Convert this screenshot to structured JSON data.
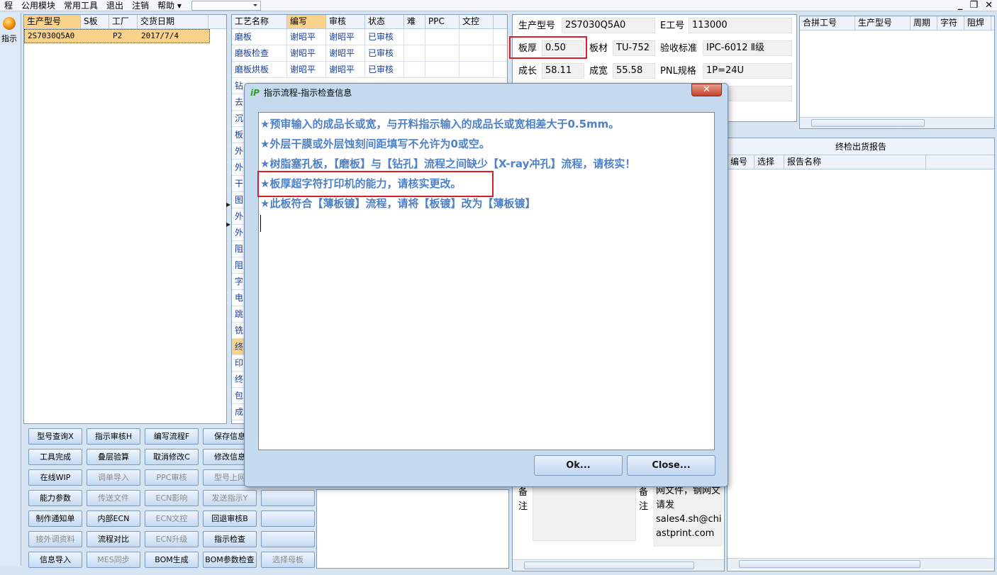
{
  "menubar": {
    "items": [
      "程",
      "公用模块",
      "常用工具",
      "退出",
      "注销",
      "帮助 ▾"
    ],
    "combo_value": ""
  },
  "left_tool": {
    "label": "指示"
  },
  "orders_grid": {
    "headers": [
      "生产型号",
      "S板",
      "工厂",
      "交货日期"
    ],
    "rows": [
      [
        "2S7030Q5A0",
        "",
        "P2",
        "2017/7/4"
      ]
    ]
  },
  "process_grid": {
    "headers": [
      "工艺名称",
      "编写",
      "审核",
      "状态",
      "难",
      "PPC",
      "文控"
    ],
    "rows": [
      [
        "磨板",
        "谢昭平",
        "谢昭平",
        "已审核"
      ],
      [
        "磨板检查",
        "谢昭平",
        "谢昭平",
        "已审核"
      ],
      [
        "磨板烘板",
        "谢昭平",
        "谢昭平",
        "已审核"
      ]
    ],
    "partial_names": [
      "钻",
      "去",
      "沉",
      "板",
      "外",
      "外",
      "干",
      "图",
      "外",
      "外",
      "阻",
      "阻",
      "字",
      "电",
      "跳",
      "铣",
      "终",
      "印",
      "终",
      "包",
      "成"
    ]
  },
  "buttons": [
    [
      "型号查询X",
      "指示审核H",
      "编写流程F",
      "保存信息"
    ],
    [
      "工具完成",
      "叠层验算",
      "取消修改C",
      "修改信息"
    ],
    [
      "在线WIP",
      "调单导入",
      "PPC审核",
      "型号上网"
    ],
    [
      "能力参数",
      "传送文件",
      "ECN影响",
      "发送指示Y"
    ],
    [
      "制作通知单",
      "内部ECN",
      "ECN文控",
      "回退审核B"
    ],
    [
      "接外调资料",
      "流程对比",
      "ECN升级",
      "指示检查"
    ],
    [
      "信息导入",
      "MES同步",
      "BOM生成",
      "BOM参数检查",
      "选择母板"
    ]
  ],
  "info": {
    "model_label": "生产型号",
    "model_value": "2S7030Q5A0",
    "eno_label": "E工号",
    "eno_value": "113000",
    "thick_label": "板厚",
    "thick_value": "0.50",
    "material_label": "板材",
    "material_value": "TU-752",
    "standard_label": "验收标准",
    "standard_value": "IPC-6012 Ⅱ级",
    "len_label": "成长",
    "len_value": "58.11",
    "wid_label": "成宽",
    "wid_value": "55.58",
    "pnl_label": "PNL规格",
    "pnl_value": "1P=24U"
  },
  "merge_grid": {
    "headers": [
      "合拼工号",
      "生产型号",
      "周期",
      "字符",
      "阻焊"
    ]
  },
  "report": {
    "title": "终检出货报告",
    "headers": [
      "编号",
      "选择",
      "报告名称"
    ]
  },
  "notes": {
    "label_a": "备注",
    "label_b": "备注",
    "lines": [
      "网文件，钢网文",
      "请发",
      "sales4.sh@chi",
      "astprint.com"
    ]
  },
  "dialog": {
    "title": "指示流程-指示检查信息",
    "messages": [
      "★预审输入的成品长或宽，与开料指示输入的成品长或宽相差大于0.5mm。",
      "★外层干膜或外层蚀刻间距填写不允许为0或空。",
      "★树脂塞孔板，【磨板】与【钻孔】流程之间缺少【X-ray冲孔】流程，请核实！",
      "★板厚超字符打印机的能力，请核实更改。",
      "★此板符合【薄板镀】流程，请将【板镀】改为【薄板镀】"
    ],
    "ok_label": "Ok...",
    "close_label": "Close..."
  },
  "colors": {
    "highlight_red": "#d61f26",
    "message_blue": "#4f81c7",
    "selected_row": "#fbd28a"
  }
}
